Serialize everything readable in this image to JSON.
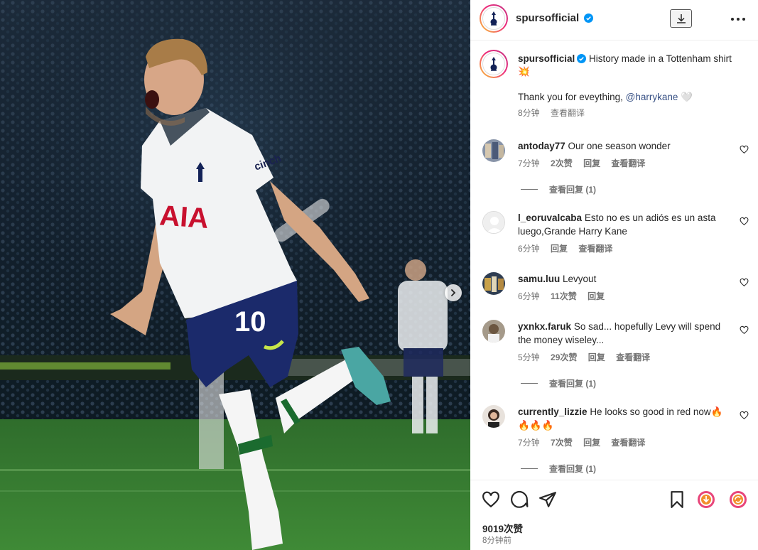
{
  "post": {
    "username": "spursofficial",
    "caption_text": "History made in a Tottenham shirt",
    "caption_emoji": "💥",
    "thanks_text": "Thank you for eveything,",
    "mention": "@harrykane",
    "mention_trailing": "🤍",
    "time": "8分钟",
    "translate": "查看翻译"
  },
  "comments": [
    {
      "user": "antoday77",
      "text": "Our one season wonder",
      "time": "7分钟",
      "likes": "2次赞",
      "reply": "回复",
      "translate": "查看翻译",
      "view_replies": "查看回复 (1)"
    },
    {
      "user": "l_eoruvalcaba",
      "text": "Esto no es un adiós es un asta luego,Grande Harry Kane",
      "time": "6分钟",
      "likes": "",
      "reply": "回复",
      "translate": "查看翻译",
      "view_replies": ""
    },
    {
      "user": "samu.luu",
      "text": "Levyout",
      "time": "6分钟",
      "likes": "11次赞",
      "reply": "回复",
      "translate": "",
      "view_replies": ""
    },
    {
      "user": "yxnkx.faruk",
      "text": "So sad... hopefully Levy will spend the money wiseley...",
      "time": "5分钟",
      "likes": "29次赞",
      "reply": "回复",
      "translate": "查看翻译",
      "view_replies": "查看回复 (1)"
    },
    {
      "user": "currently_lizzie",
      "text": "He looks so good in red now🔥🔥🔥🔥",
      "time": "7分钟",
      "likes": "7次赞",
      "reply": "回复",
      "translate": "查看翻译",
      "view_replies": "查看回复 (1)"
    }
  ],
  "footer": {
    "likes": "9019次赞",
    "time": "8分钟前"
  },
  "photo": {
    "sponsor": "AIA",
    "shirt_number": "10",
    "sleeve_sponsor": "cinch"
  },
  "icons": [
    "heart-icon",
    "comment-icon",
    "share-icon",
    "bookmark-icon",
    "download-icon",
    "more-icon",
    "verified-icon",
    "next-arrow-icon"
  ],
  "colors": {
    "link": "#385185",
    "verified": "#0095f6",
    "muted": "#737373"
  }
}
